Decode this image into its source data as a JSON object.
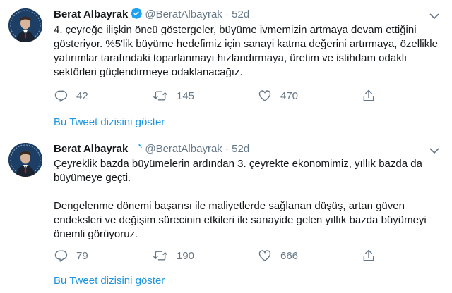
{
  "colors": {
    "link": "#1b95e0",
    "muted": "#657786",
    "verified": "#1da1f2",
    "avatar_bg": "#1d3f66"
  },
  "tweets": [
    {
      "author_name": "Berat Albayrak",
      "handle": "@BeratAlbayrak",
      "separator": "·",
      "time": "52d",
      "text": "4. çeyreğe ilişkin öncü göstergeler, büyüme ivmemizin artmaya devam ettiğini gösteriyor. %5'lik büyüme hedefimiz için sanayi katma değerini artırmaya, özellikle yatırımlar tarafındaki toparlanmayı hızlandırmaya, üretim ve istihdam odaklı sektörleri güçlendirmeye odaklanacağız.",
      "replies": "42",
      "retweets": "145",
      "likes": "470",
      "thread_link": "Bu Tweet dizisini göster"
    },
    {
      "author_name": "Berat Albayrak",
      "handle": "@BeratAlbayrak",
      "separator": "·",
      "time": "52d",
      "text": "Çeyreklik bazda büyümelerin ardından 3. çeyrekte ekonomimiz, yıllık bazda da büyümeye geçti.\n\nDengelenme dönemi başarısı ile maliyetlerde sağlanan düşüş, artan güven endeksleri ve değişim sürecinin etkileri ile sanayide gelen yıllık bazda büyümeyi önemli görüyoruz.",
      "replies": "79",
      "retweets": "190",
      "likes": "666",
      "thread_link": "Bu Tweet dizisini göster"
    }
  ]
}
